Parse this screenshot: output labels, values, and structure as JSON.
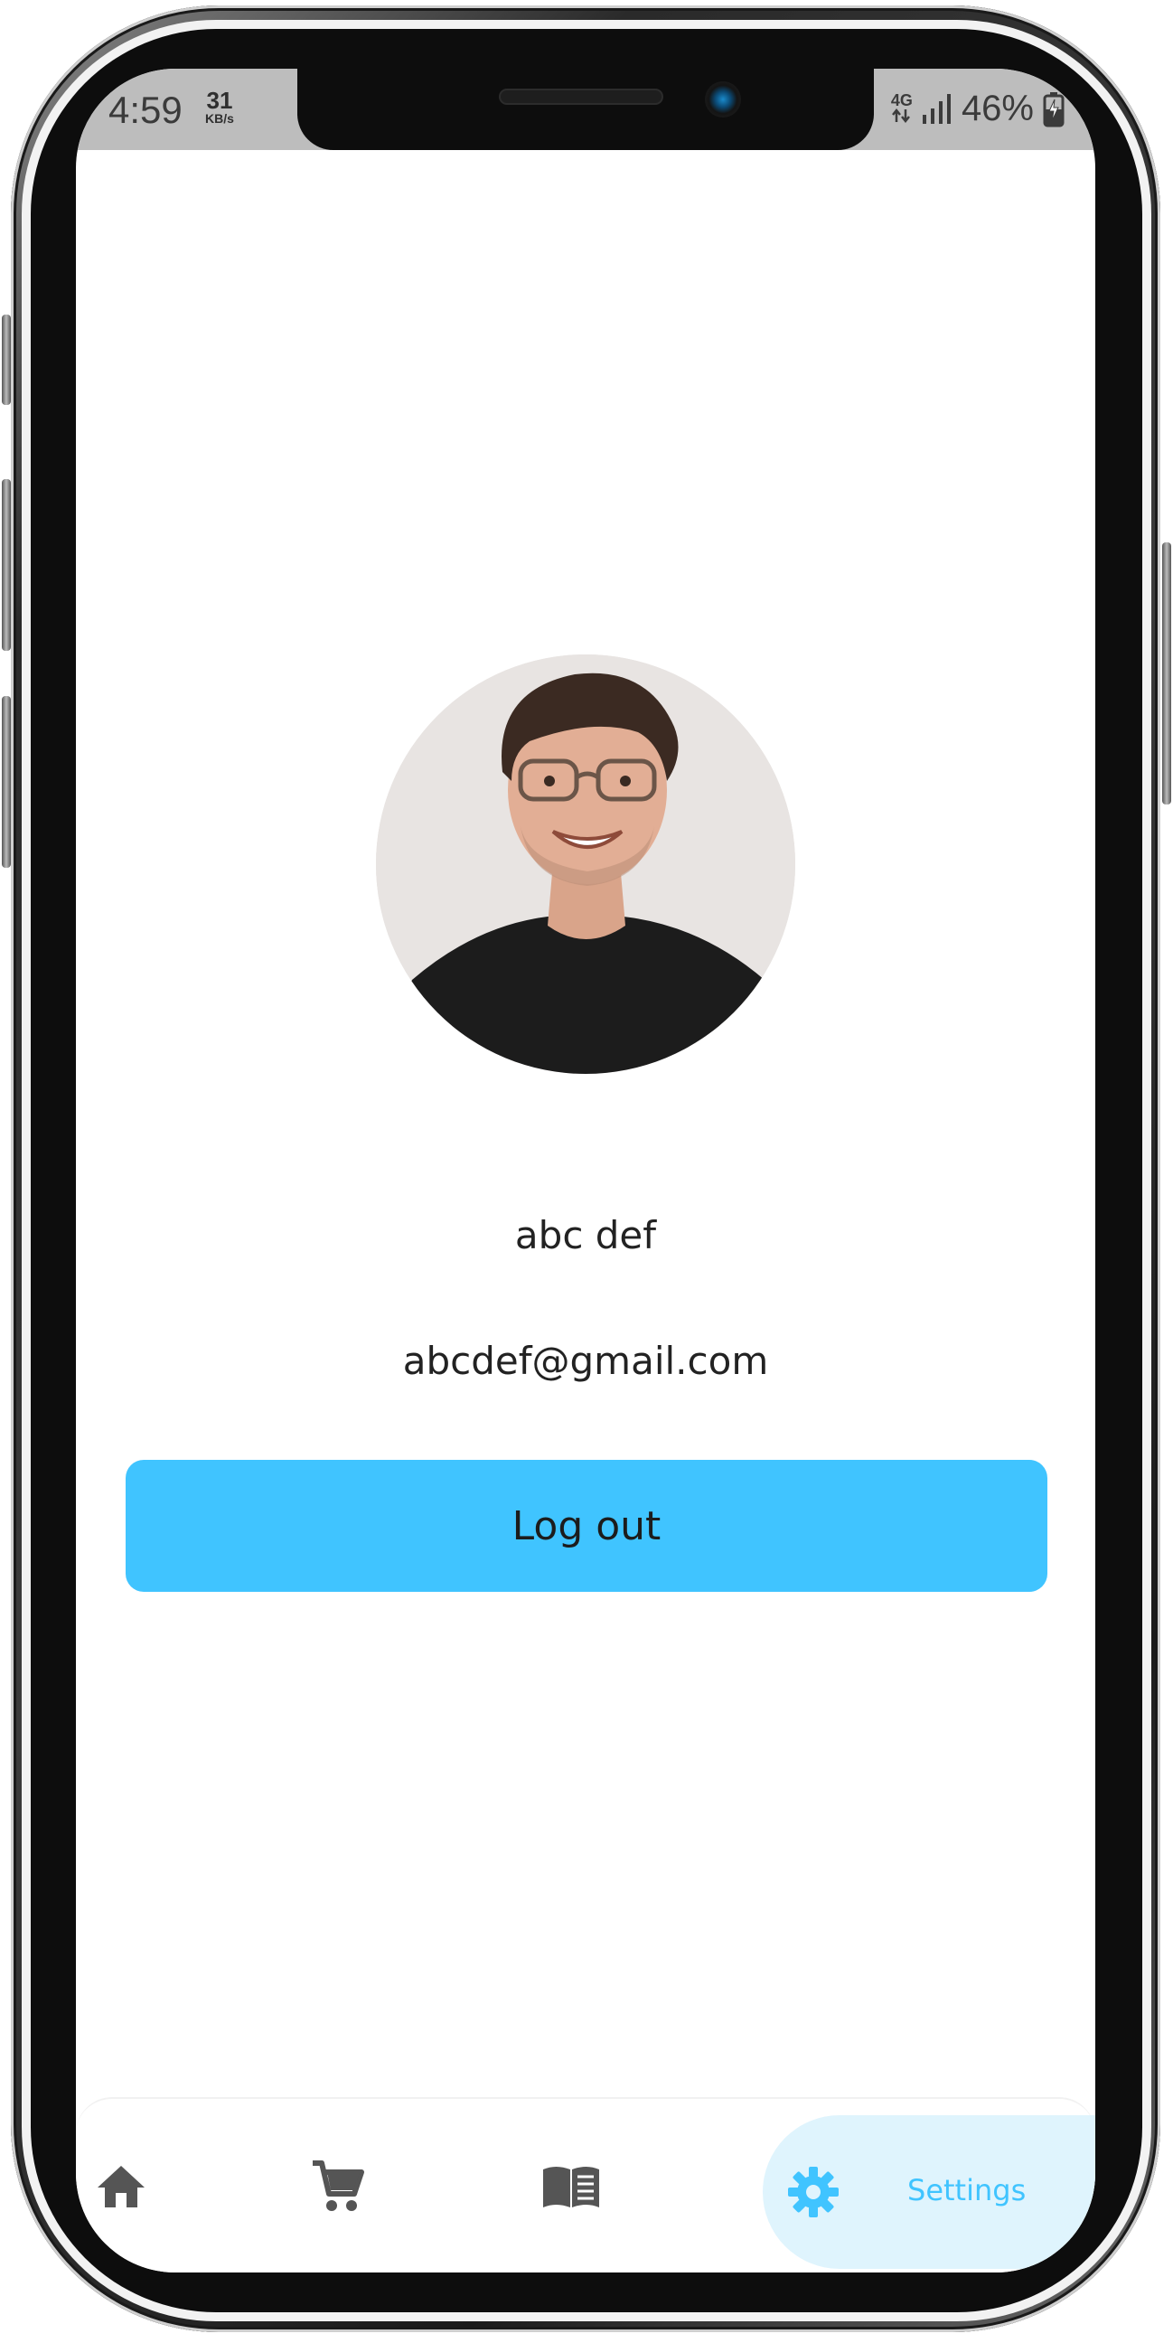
{
  "status_bar": {
    "time": "4:59",
    "speed_value": "31",
    "speed_unit": "KB/s",
    "network": "4G",
    "battery": "46%"
  },
  "profile": {
    "name": "abc def",
    "email": "abcdef@gmail.com",
    "logout_label": "Log out"
  },
  "bottom_nav": {
    "items": [
      {
        "icon": "home-icon",
        "label": ""
      },
      {
        "icon": "cart-icon",
        "label": ""
      },
      {
        "icon": "book-icon",
        "label": ""
      },
      {
        "icon": "gear-icon",
        "label": "Settings"
      }
    ],
    "active_index": 3
  },
  "colors": {
    "accent": "#40c4ff",
    "active_tab_bg": "#dff4fd",
    "status_bar_bg": "#bdbdbd",
    "text": "#222222",
    "icon_inactive": "#555555"
  }
}
